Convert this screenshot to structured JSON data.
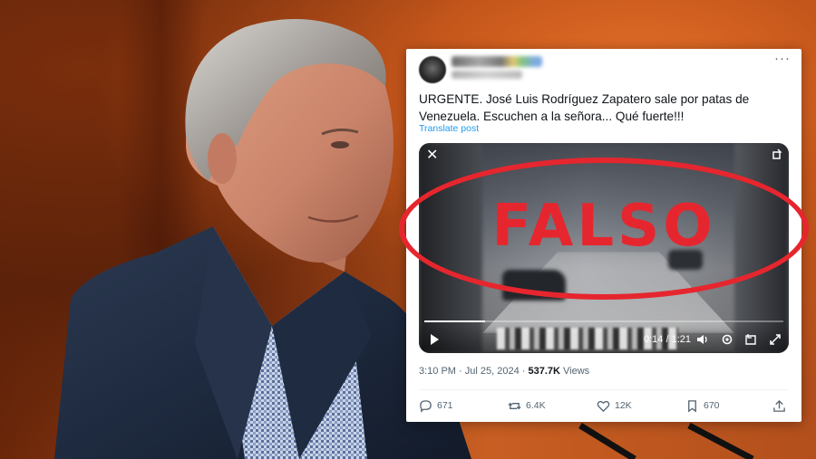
{
  "tweet": {
    "text": "URGENTE. José Luis Rodríguez Zapatero sale por patas de Venezuela. Escuchen a la señora... Qué fuerte!!!",
    "translate_label": "Translate post",
    "more_label": "···",
    "video": {
      "time": "0:14 / 1:21",
      "progress": 0.17
    },
    "meta": {
      "time": "3:10 PM",
      "separator": " · ",
      "date": "Jul 25, 2024",
      "views_count": "537.7K",
      "views_label": " Views"
    },
    "actions": {
      "replies": "671",
      "reposts": "6.4K",
      "likes": "12K",
      "bookmarks": "670"
    }
  },
  "stamp": {
    "label": "FALSO",
    "color": "#e6262e"
  },
  "colors": {
    "link": "#1d9bf0",
    "muted": "#536471",
    "background_orange": "#c85e22"
  }
}
